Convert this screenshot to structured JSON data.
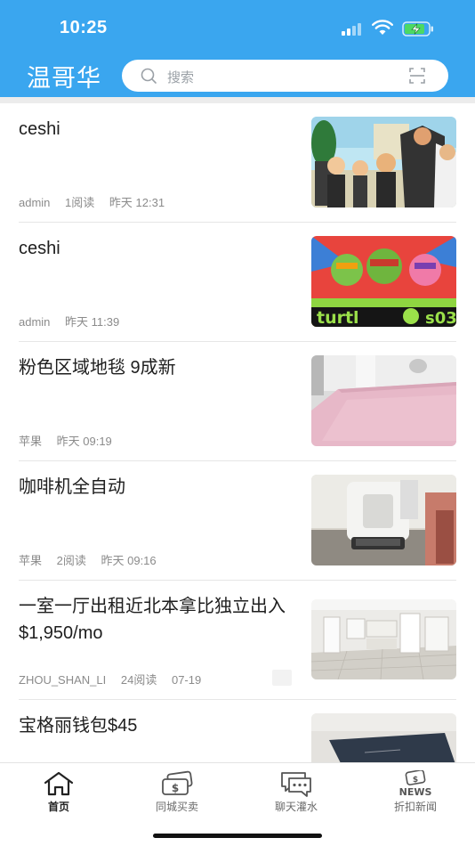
{
  "status_bar": {
    "time": "10:25"
  },
  "header": {
    "city": "温哥华",
    "search_placeholder": "搜索",
    "accent_color": "#3aa6ef"
  },
  "feed": [
    {
      "title": "ceshi",
      "author": "admin",
      "reads": "1阅读",
      "time": "昨天 12:31",
      "image": "anime-group-scene"
    },
    {
      "title": "ceshi",
      "author": "admin",
      "reads": "",
      "time": "昨天 11:39",
      "image": "cartoon-turtles-poster"
    },
    {
      "title": "粉色区域地毯 9成新",
      "author": "苹果",
      "reads": "",
      "time": "昨天 09:19",
      "image": "pink-rug"
    },
    {
      "title": "咖啡机全自动",
      "author": "苹果",
      "reads": "2阅读",
      "time": "昨天 09:16",
      "image": "coffee-machine"
    },
    {
      "title": "一室一厅出租近北本拿比独立出入 $1,950/mo",
      "author": "ZHOU_SHAN_LI",
      "reads": "24阅读",
      "time": "07-19",
      "image": "empty-room"
    },
    {
      "title": "宝格丽钱包$45",
      "author": "",
      "reads": "",
      "time": "",
      "image": "wallet"
    }
  ],
  "tabs": [
    {
      "label": "首页",
      "icon": "home-icon",
      "active": true
    },
    {
      "label": "同城买卖",
      "icon": "money-icon",
      "active": false
    },
    {
      "label": "聊天灌水",
      "icon": "chat-icon",
      "active": false
    },
    {
      "label": "折扣新闻",
      "icon": "news-icon",
      "active": false
    }
  ]
}
